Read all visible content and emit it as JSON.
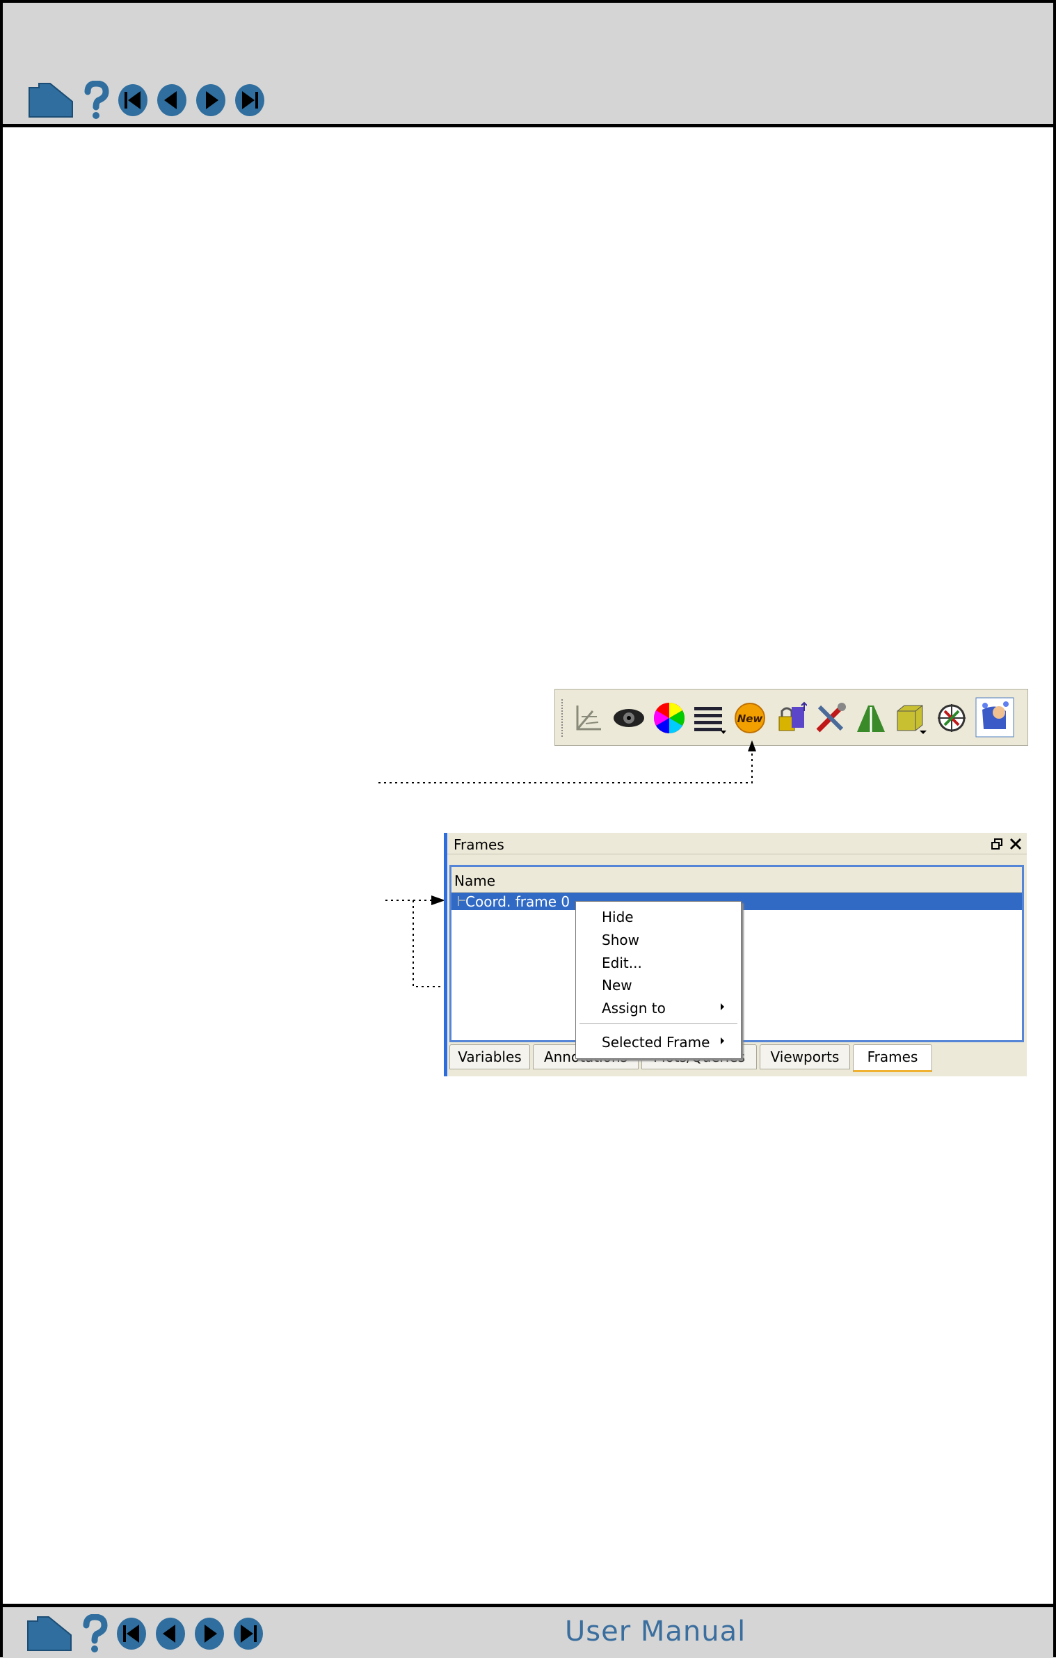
{
  "header": {
    "nav_icons": [
      "home-icon",
      "help-icon",
      "first-page-icon",
      "previous-page-icon",
      "next-page-icon",
      "last-page-icon"
    ]
  },
  "footer": {
    "title": "User Manual",
    "nav_icons": [
      "home-icon",
      "help-icon",
      "first-page-icon",
      "previous-page-icon",
      "next-page-icon",
      "last-page-icon"
    ]
  },
  "toolbar": {
    "buttons": [
      "axes-icon",
      "eye-icon",
      "color-wheel-icon",
      "lines-icon",
      "new-frame-icon",
      "lock-icon",
      "tools-icon",
      "road-icon",
      "box-icon",
      "compass-icon",
      "selection-icon"
    ],
    "new_button_label": "New"
  },
  "frames_panel": {
    "title": "Frames",
    "column_header": "Name",
    "rows": [
      "Coord. frame 0"
    ],
    "context_menu": {
      "items": [
        "Hide",
        "Show",
        "Edit...",
        "New",
        "Assign to",
        "Selected Frame"
      ]
    },
    "tabs": [
      "Variables",
      "Annotations",
      "Plots/Queries",
      "Viewports",
      "Frames"
    ],
    "active_tab": "Frames"
  },
  "colors": {
    "nav_blue": "#2f6e9e",
    "bar_gray": "#d5d5d5",
    "selection_blue": "#316ac5",
    "panel_beige": "#ece9d8"
  }
}
